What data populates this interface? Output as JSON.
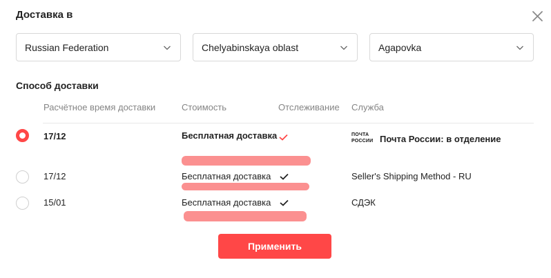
{
  "header": {
    "title": "Доставка в"
  },
  "icons": {
    "close": "close-icon",
    "chevron": "chevron-down-icon",
    "check": "check-icon"
  },
  "selects": {
    "country": "Russian Federation",
    "region": "Chelyabinskaya oblast",
    "city": "Agapovka"
  },
  "section": {
    "title": "Способ доставки"
  },
  "columns": {
    "time": "Расчётное время доставки",
    "cost": "Стоимость",
    "tracking": "Отслеживание",
    "service": "Служба"
  },
  "options": [
    {
      "selected": true,
      "date": "17/12",
      "price": "Бесплатная доставка",
      "tracking": true,
      "service": "Почта России: в отделение",
      "service_logo": "ПОЧТА РОССИИ"
    },
    {
      "selected": false,
      "date": "17/12",
      "price": "Бесплатная доставка",
      "tracking": true,
      "service": "Seller's Shipping Method - RU"
    },
    {
      "selected": false,
      "date": "15/01",
      "price": "Бесплатная доставка",
      "tracking": true,
      "service": "СДЭК"
    }
  ],
  "actions": {
    "apply": "Применить"
  },
  "colors": {
    "accent": "#ff4747",
    "redaction": "#fb8a8a",
    "muted": "#858585"
  }
}
